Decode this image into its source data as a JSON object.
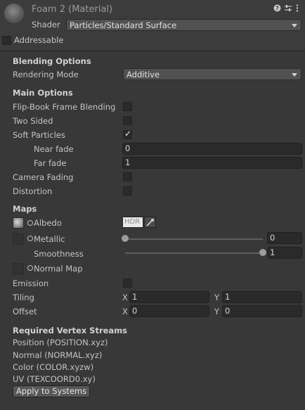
{
  "header": {
    "title": "Foam 2 (Material)",
    "shader_label": "Shader",
    "shader_value": "Particles/Standard Surface",
    "addressable_label": "Addressable",
    "icons": [
      "help-icon",
      "preset-icon",
      "more-icon"
    ]
  },
  "blending": {
    "heading": "Blending Options",
    "rendering_mode_label": "Rendering Mode",
    "rendering_mode_value": "Additive"
  },
  "main_options": {
    "heading": "Main Options",
    "flipbook_label": "Flip-Book Frame Blending",
    "two_sided_label": "Two Sided",
    "soft_particles_label": "Soft Particles",
    "soft_particles_checked": true,
    "near_fade_label": "Near fade",
    "near_fade_value": "0",
    "far_fade_label": "Far fade",
    "far_fade_value": "1",
    "camera_fading_label": "Camera Fading",
    "distortion_label": "Distortion"
  },
  "maps": {
    "heading": "Maps",
    "albedo_label": "Albedo",
    "hdr_label": "HDR",
    "metallic_label": "Metallic",
    "metallic_value": "0",
    "metallic_fraction": 0.0,
    "smoothness_label": "Smoothness",
    "smoothness_value": "1",
    "smoothness_fraction": 1.0,
    "normal_map_label": "Normal Map",
    "emission_label": "Emission",
    "tiling_label": "Tiling",
    "tiling_x_label": "X",
    "tiling_x": "1",
    "tiling_y_label": "Y",
    "tiling_y": "1",
    "offset_label": "Offset",
    "offset_x_label": "X",
    "offset_x": "0",
    "offset_y_label": "Y",
    "offset_y": "0"
  },
  "vertex_streams": {
    "heading": "Required Vertex Streams",
    "streams": [
      "Position (POSITION.xyz)",
      "Normal (NORMAL.xyz)",
      "Color (COLOR.xyzw)",
      "UV (TEXCOORD0.xy)"
    ],
    "apply_button": "Apply to Systems"
  }
}
